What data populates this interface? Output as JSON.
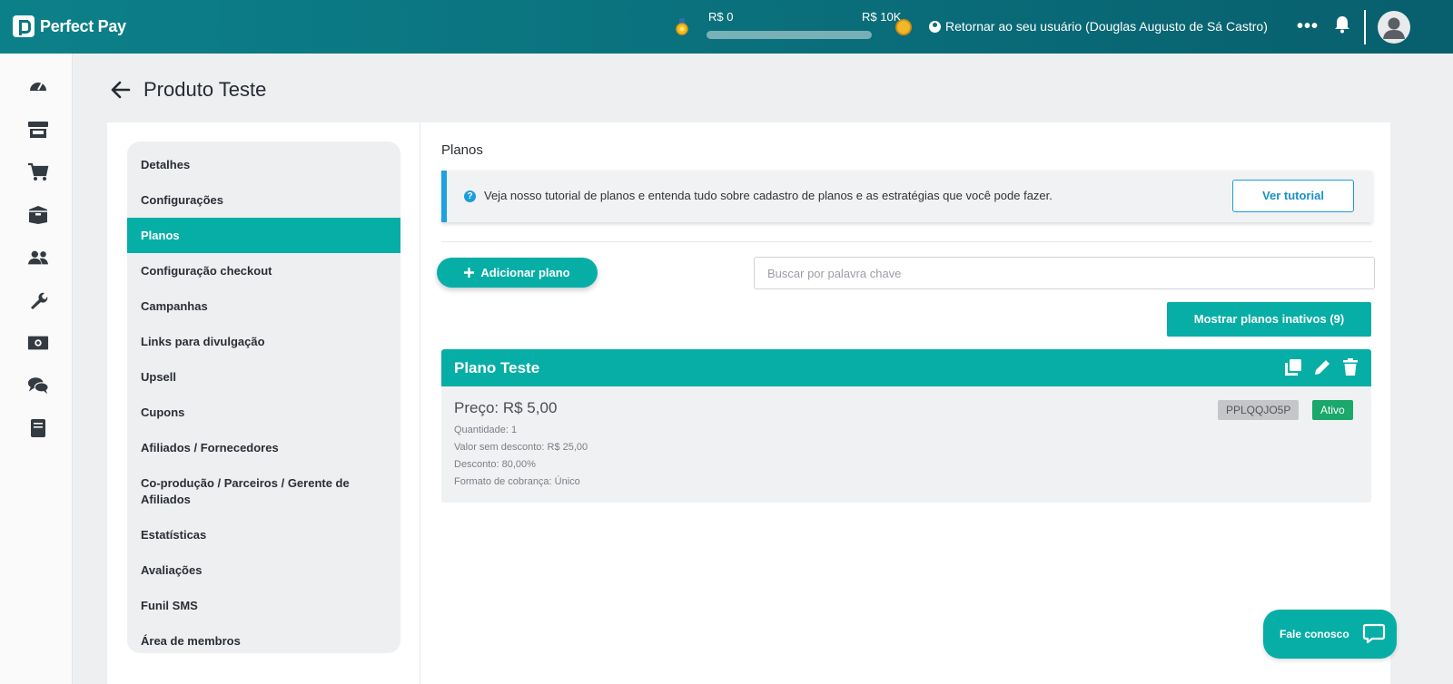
{
  "app": {
    "name": "Perfect Pay"
  },
  "topbar": {
    "progress": {
      "min_label": "R$ 0",
      "max_label": "R$ 10K",
      "fraction": 0.0
    },
    "return_user_label": "Retornar ao seu usuário (Douglas Augusto de Sá Castro)",
    "more_icon": "•••"
  },
  "rail": {
    "icons": [
      "dashboard-icon",
      "store-icon",
      "cart-icon",
      "box-icon",
      "users-icon",
      "wrench-icon",
      "money-icon",
      "chat-icon",
      "book-icon"
    ]
  },
  "page": {
    "title": "Produto Teste"
  },
  "nav": {
    "items": [
      {
        "label": "Detalhes"
      },
      {
        "label": "Configurações"
      },
      {
        "label": "Planos",
        "active": true
      },
      {
        "label": "Configuração checkout"
      },
      {
        "label": "Campanhas"
      },
      {
        "label": "Links para divulgação"
      },
      {
        "label": "Upsell"
      },
      {
        "label": "Cupons"
      },
      {
        "label": "Afiliados / Fornecedores"
      },
      {
        "label": "Co-produção / Parceiros / Gerente de Afiliados"
      },
      {
        "label": "Estatísticas"
      },
      {
        "label": "Avaliações"
      },
      {
        "label": "Funil SMS"
      },
      {
        "label": "Área de membros"
      }
    ]
  },
  "plans": {
    "section_title": "Planos",
    "tutorial": {
      "text": "Veja nosso tutorial de planos e entenda tudo sobre cadastro de planos e as estratégias que você pode fazer.",
      "button_label": "Ver tutorial"
    },
    "add_button_label": "Adicionar plano",
    "search": {
      "placeholder": "Buscar por palavra chave",
      "value": ""
    },
    "inactive_button_label": "Mostrar planos inativos (9)",
    "card": {
      "name": "Plano Teste",
      "price": "Preço: R$ 5,00",
      "quantity": "Quantidade: 1",
      "value_without_discount": "Valor sem desconto: R$ 25,00",
      "discount": "Desconto: 80,00%",
      "billing_format": "Formato de cobrança: Único",
      "code": "PPLQQJO5P",
      "status": "Ativo",
      "colors": {
        "header": "#07aea6",
        "status": "#1aa86b"
      }
    }
  },
  "chat": {
    "label": "Fale conosco"
  },
  "colors": {
    "topbar": "#0a6f7b",
    "accent": "#07aea6",
    "info": "#1ea1e0"
  }
}
